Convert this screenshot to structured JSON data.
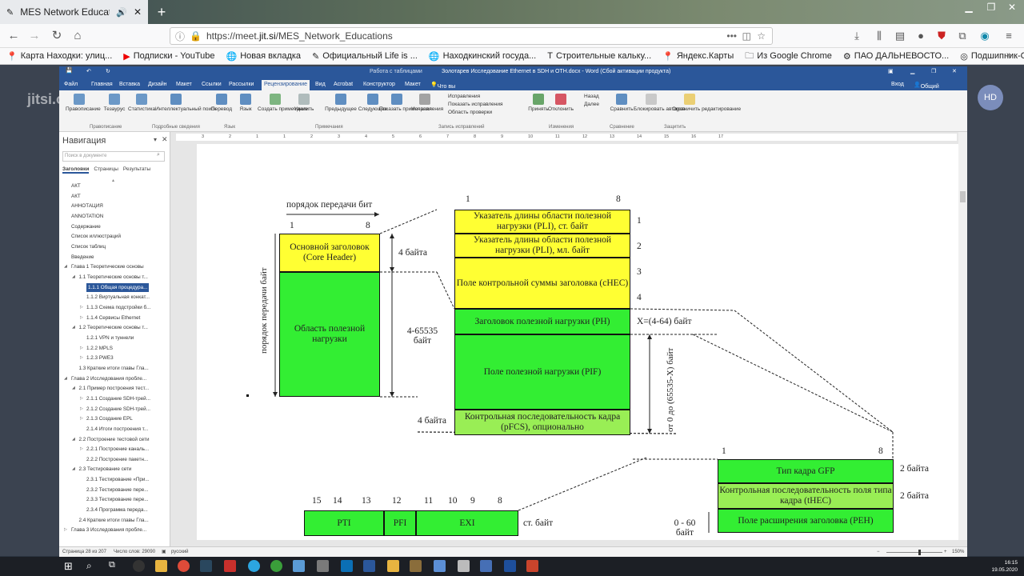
{
  "browser": {
    "tab_title": "MES Network Educations | J",
    "url_prefix": "https://meet.",
    "url_domain": "jit.si",
    "url_path": "/MES_Network_Educations",
    "bookmarks": [
      {
        "label": "Карта Находки: улиц...",
        "icon": "map-pin-icon"
      },
      {
        "label": "Подписки - YouTube",
        "icon": "youtube-icon"
      },
      {
        "label": "Новая вкладка",
        "icon": "globe-icon"
      },
      {
        "label": "Официальный Life is ...",
        "icon": "pen-icon"
      },
      {
        "label": "Находкинский госуда...",
        "icon": "globe-icon"
      },
      {
        "label": "Строительные кальку...",
        "icon": "t-icon"
      },
      {
        "label": "Яндекс.Карты",
        "icon": "map-pin-icon"
      },
      {
        "label": "Из Google Chrome",
        "icon": "folder-icon"
      },
      {
        "label": "ПАО ДАЛЬНЕВОСТО...",
        "icon": "gear-icon"
      },
      {
        "label": "Подшипник-Сервис ...",
        "icon": "bearing-icon"
      }
    ]
  },
  "jitsi": {
    "avatar_initials": "HD",
    "watermark": "jitsi.org"
  },
  "word": {
    "context_tab": "Работа с таблицами",
    "title": "Золотарев Исследование Ethernet в SDH и OTH.docx - Word (Сбой активации продукта)",
    "menu": [
      "Файл",
      "Главная",
      "Вставка",
      "Дизайн",
      "Макет",
      "Ссылки",
      "Рассылки",
      "Рецензирование",
      "Вид",
      "Acrobat",
      "Конструктор",
      "Макет"
    ],
    "tell_me": "Что вы хотите сделать?",
    "signin": "Вход",
    "share": "Общий доступ",
    "ribbon": {
      "buttons": [
        "Правописание",
        "Тезаурус",
        "Статистика",
        "Интеллектуальный поиск",
        "Перевод",
        "Язык",
        "Создать примечание",
        "Удалить",
        "Предыдущее",
        "Следующее",
        "Показать примечания",
        "Исправления",
        "Принять",
        "Отклонить",
        "Сравнить",
        "Блокировать авторов",
        "Ограничить редактирование"
      ],
      "track_items": [
        "Исправления",
        "Показать исправления",
        "Область проверки"
      ],
      "nav_items": [
        "Назад",
        "Далее"
      ],
      "groups": [
        "Правописание",
        "Подробные сведения",
        "Язык",
        "Примечания",
        "Запись исправлений",
        "Изменения",
        "Сравнение",
        "Защитить"
      ]
    },
    "nav": {
      "title": "Навигация",
      "search_placeholder": "Поиск в документе",
      "tabs": [
        "Заголовки",
        "Страницы",
        "Результаты"
      ],
      "items": [
        {
          "label": "АКТ",
          "level": 0,
          "arrow": ""
        },
        {
          "label": "АКТ",
          "level": 0,
          "arrow": ""
        },
        {
          "label": "АННОТАЦИЯ",
          "level": 0,
          "arrow": ""
        },
        {
          "label": "ANNOTATION",
          "level": 0,
          "arrow": ""
        },
        {
          "label": "Содержание",
          "level": 0,
          "arrow": ""
        },
        {
          "label": "Список иллюстраций",
          "level": 0,
          "arrow": ""
        },
        {
          "label": "Список таблиц",
          "level": 0,
          "arrow": ""
        },
        {
          "label": "Введение",
          "level": 0,
          "arrow": ""
        },
        {
          "label": "Глава 1 Теоретические основы",
          "level": 0,
          "arrow": "◢"
        },
        {
          "label": "1.1 Теоретические основы т...",
          "level": 1,
          "arrow": "◢"
        },
        {
          "label": "1.1.1 Общая процедура...",
          "level": 2,
          "arrow": "",
          "selected": true
        },
        {
          "label": "1.1.2 Виртуальная конкат...",
          "level": 2,
          "arrow": ""
        },
        {
          "label": "1.1.3 Схема подстройки б...",
          "level": 2,
          "arrow": "▷"
        },
        {
          "label": "1.1.4 Сервисы Ethernet",
          "level": 2,
          "arrow": "▷"
        },
        {
          "label": "1.2 Теоретические основы т...",
          "level": 1,
          "arrow": "◢"
        },
        {
          "label": "1.2.1 VPN и туннели",
          "level": 2,
          "arrow": ""
        },
        {
          "label": "1.2.2 MPLS",
          "level": 2,
          "arrow": "▷"
        },
        {
          "label": "1.2.3 PWE3",
          "level": 2,
          "arrow": "▷"
        },
        {
          "label": "1.3 Краткие итоги главы Гла...",
          "level": 1,
          "arrow": ""
        },
        {
          "label": "Глава 2 Исследования пробле...",
          "level": 0,
          "arrow": "◢"
        },
        {
          "label": "2.1 Пример построения тест...",
          "level": 1,
          "arrow": "◢"
        },
        {
          "label": "2.1.1 Создание SDH-трей...",
          "level": 2,
          "arrow": "▷"
        },
        {
          "label": "2.1.2 Создание SDH-трей...",
          "level": 2,
          "arrow": "▷"
        },
        {
          "label": "2.1.3 Создание EPL",
          "level": 2,
          "arrow": "▷"
        },
        {
          "label": "2.1.4 Итоги построения т...",
          "level": 2,
          "arrow": ""
        },
        {
          "label": "2.2 Построение тестовой сети",
          "level": 1,
          "arrow": "◢"
        },
        {
          "label": "2.2.1 Построение каналь...",
          "level": 2,
          "arrow": "▷"
        },
        {
          "label": "2.2.2 Построение пакетн...",
          "level": 2,
          "arrow": ""
        },
        {
          "label": "2.3 Тестирование сети",
          "level": 1,
          "arrow": "◢"
        },
        {
          "label": "2.3.1 Тестирование «При...",
          "level": 2,
          "arrow": ""
        },
        {
          "label": "2.3.2 Тестирование пере...",
          "level": 2,
          "arrow": ""
        },
        {
          "label": "2.3.3 Тестирование пере...",
          "level": 2,
          "arrow": ""
        },
        {
          "label": "2.3.4 Программа переда...",
          "level": 2,
          "arrow": ""
        },
        {
          "label": "2.4 Краткие итоги главы Гла...",
          "level": 1,
          "arrow": ""
        },
        {
          "label": "Глава 3 Исследования пробле...",
          "level": 0,
          "arrow": "▷"
        }
      ]
    },
    "ruler_numbers": [
      "3",
      "2",
      "1",
      "1",
      "2",
      "3",
      "4",
      "5",
      "6",
      "7",
      "8",
      "9",
      "10",
      "11",
      "12",
      "13",
      "14",
      "15",
      "16",
      "17"
    ],
    "status": {
      "page": "Страница 28 из 207",
      "words": "Число слов: 29090",
      "lang": "русский",
      "zoom": "150%"
    }
  },
  "figure": {
    "left_caption": "порядок передачи бит",
    "left_col1": "1",
    "left_col8": "8",
    "left_vertical": "порядок передачи байт",
    "core_header": "Основной заголовок (Core Header)",
    "payload_area": "Область полезной нагрузки",
    "bytes4": "4 байта",
    "bytes4_65535": "4-65535 байт",
    "bytes4_b": "4 байта",
    "right_col1": "1",
    "right_col8": "8",
    "pli_hi": "Указатель длины области полезной нагрузки (PLI), ст. байт",
    "pli_lo": "Указатель длины области полезной нагрузки (PLI), мл. байт",
    "chec": "Поле контрольной суммы заголовка (cHEC)",
    "phdr": "Заголовок полезной нагрузки (PH)",
    "pif": "Поле полезной нагрузки (PIF)",
    "pfcs": "Контрольная последовательность кадра (pFCS), опционально",
    "row_nums": [
      "1",
      "2",
      "3",
      "4"
    ],
    "x_bytes": "X=(4-64) байт",
    "range_vertical": "от 0 до (65535-X) байт",
    "gfp_col1": "1",
    "gfp_col8": "8",
    "gfp_type": "Тип кадра GFP",
    "thec": "Контрольная последовательность поля типа кадра (tHEC)",
    "ehdr": "Поле расширения заголовка (PEH)",
    "bytes2a": "2 байта",
    "bytes2b": "2 байта",
    "bytes0_60": "0 - 60 байт",
    "bottom_cols": [
      "15",
      "14",
      "13",
      "12",
      "11",
      "10",
      "9",
      "8"
    ],
    "pti": "PTI",
    "pfi": "PFI",
    "exi": "EXI",
    "st_byte": "ст. байт"
  },
  "taskbar": {
    "time": "16:15",
    "date": "19.05.2020"
  }
}
